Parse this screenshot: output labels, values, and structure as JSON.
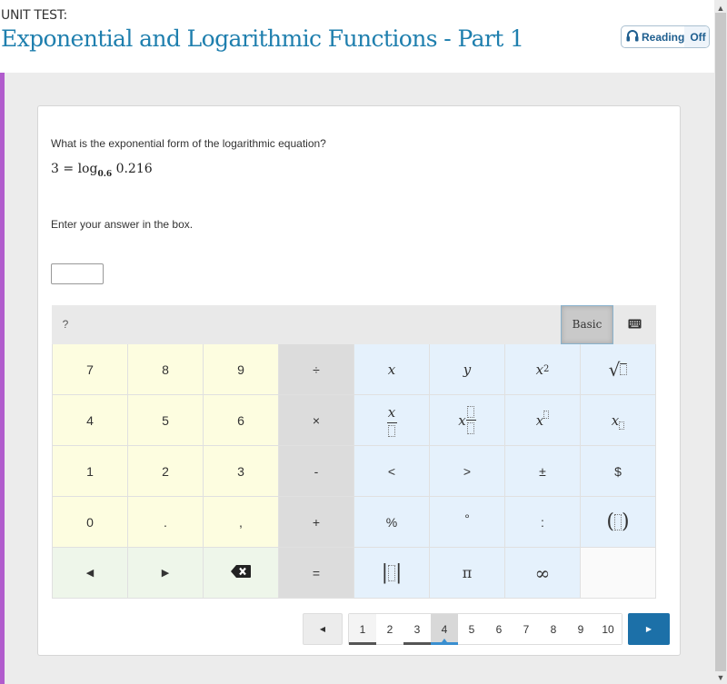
{
  "header": {
    "unit_label": "UNIT TEST:",
    "title": "Exponential and Logarithmic Functions - Part 1",
    "reading": {
      "icon": "headphones-icon",
      "label": "Reading",
      "state": "Off"
    }
  },
  "question": {
    "prompt": "What is the exponential form of the logarithmic equation?",
    "equation": {
      "lhs": "3",
      "eq": "=",
      "func": "log",
      "base": "0.6",
      "arg": "0.216"
    },
    "instruction": "Enter your answer in the box.",
    "answer_value": ""
  },
  "keypad": {
    "help_label": "?",
    "mode_label": "Basic",
    "keyboard_icon": "keyboard-icon",
    "rows": [
      [
        "7",
        "8",
        "9",
        "÷",
        "x",
        "y",
        "x²",
        "√□"
      ],
      [
        "4",
        "5",
        "6",
        "×",
        "x/□",
        "x □/□",
        "x^□",
        "x_□"
      ],
      [
        "1",
        "2",
        "3",
        "-",
        "<",
        ">",
        "±",
        "$"
      ],
      [
        "0",
        ".",
        ",",
        "+",
        "%",
        "°",
        ":",
        "(□)"
      ],
      [
        "◀",
        "▶",
        "⌫",
        "=",
        "|□|",
        "π",
        "∞",
        ""
      ]
    ],
    "keys": {
      "k7": "7",
      "k8": "8",
      "k9": "9",
      "div": "÷",
      "k4": "4",
      "k5": "5",
      "k6": "6",
      "mul": "×",
      "k1": "1",
      "k2": "2",
      "k3": "3",
      "minus": "-",
      "k0": "0",
      "dot": ".",
      "comma": ",",
      "plus": "+",
      "left": "◀",
      "right": "▶",
      "equals": "=",
      "x": "x",
      "y": "y",
      "x2_base": "x",
      "x2_exp": "2",
      "sqrt": "√",
      "frac_num": "x",
      "mixed_whole": "x",
      "pow_base": "x",
      "sub_base": "x",
      "lt": "<",
      "gt": ">",
      "pm": "±",
      "dollar": "$",
      "percent": "%",
      "degree": "°",
      "colon": ":",
      "lparen": "(",
      "rparen": ")",
      "abs_l": "|",
      "abs_r": "|",
      "pi": "π",
      "infinity": "∞"
    }
  },
  "pagination": {
    "prev_label": "◀",
    "next_label": "▶",
    "pages": [
      "1",
      "2",
      "3",
      "4",
      "5",
      "6",
      "7",
      "8",
      "9",
      "10"
    ],
    "current": "4",
    "visited": [
      "1",
      "3"
    ]
  }
}
